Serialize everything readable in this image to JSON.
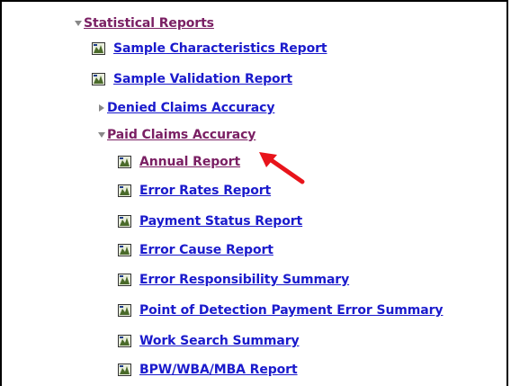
{
  "tree": {
    "root": {
      "label": "Statistical Reports",
      "expanded": true,
      "visited": true
    },
    "items": [
      {
        "label": "Sample Characteristics Report",
        "kind": "report"
      },
      {
        "label": "Sample Validation Report",
        "kind": "report"
      },
      {
        "label": "Denied Claims Accuracy",
        "kind": "folder",
        "expanded": false
      },
      {
        "label": "Paid Claims Accuracy",
        "kind": "folder",
        "expanded": true,
        "visited": true,
        "children": [
          {
            "label": "Annual Report",
            "visited": true,
            "highlighted": true
          },
          {
            "label": "Error Rates Report"
          },
          {
            "label": "Payment Status Report"
          },
          {
            "label": "Error Cause Report"
          },
          {
            "label": "Error Responsibility Summary"
          },
          {
            "label": "Point of Detection Payment Error Summary"
          },
          {
            "label": "Work Search Summary"
          },
          {
            "label": "BPW/WBA/MBA Report"
          }
        ]
      }
    ]
  },
  "colors": {
    "link": "#1a1acc",
    "visited": "#7a1f63",
    "pointer": "#e8141b"
  },
  "icons": {
    "expanded": "triangle-down-icon",
    "collapsed": "triangle-right-icon",
    "report": "report-document-icon",
    "callout": "red-arrow-icon"
  }
}
